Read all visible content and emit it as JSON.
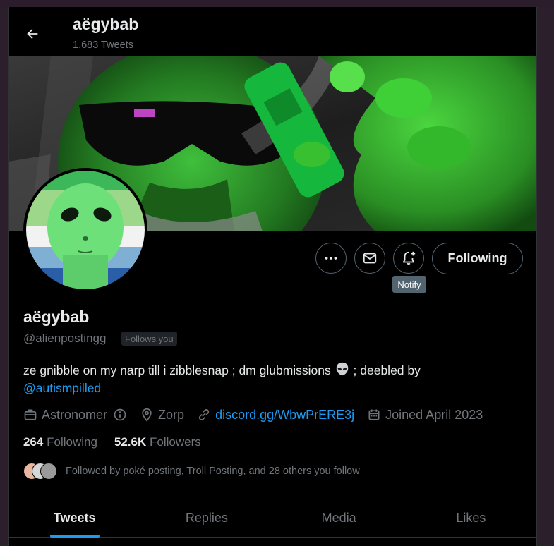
{
  "header": {
    "name": "aëgybab",
    "tweet_count": "1,683 Tweets"
  },
  "actions": {
    "following_label": "Following",
    "tooltip": "Notify"
  },
  "profile": {
    "name": "aëgybab",
    "handle": "@alienpostingg",
    "follows_you": "Follows you",
    "bio_text": "ze gnibble on my narp till i zibblesnap ; dm glubmissions",
    "bio_mid": "; deebled by",
    "bio_mention": "@autismpilled",
    "profession": "Astronomer",
    "location": "Zorp",
    "website": "discord.gg/WbwPrERE3j",
    "joined": "Joined April 2023"
  },
  "stats": {
    "following_count": "264",
    "following_label": "Following",
    "followers_count": "52.6K",
    "followers_label": "Followers"
  },
  "followed_by": "Followed by poké posting, Troll Posting, and 28 others you follow",
  "tabs": [
    "Tweets",
    "Replies",
    "Media",
    "Likes"
  ],
  "colors": {
    "accent": "#1d9bf0",
    "background": "#000000",
    "muted": "#71767b",
    "border": "#2f3336"
  }
}
